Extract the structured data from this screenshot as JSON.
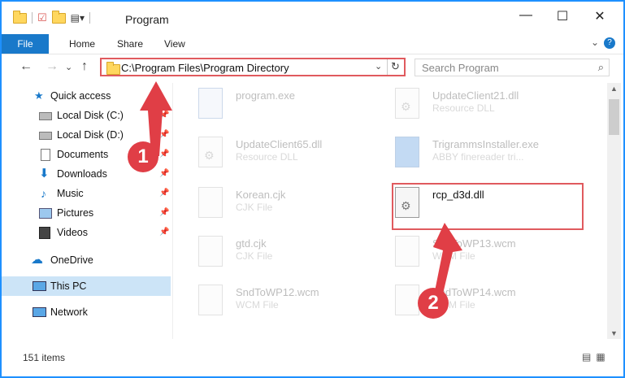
{
  "window": {
    "title": "Program",
    "minimize": "—",
    "maximize": "☐",
    "close": "✕"
  },
  "ribbon": {
    "tabs": [
      "File",
      "Home",
      "Share",
      "View"
    ],
    "help": "?"
  },
  "nav": {
    "back": "←",
    "forward": "→",
    "up": "↑",
    "address": "C:\\Program Files\\Program Directory",
    "search_placeholder": "Search Program"
  },
  "sidebar": {
    "items": [
      {
        "label": "Quick access",
        "icon": "star-icon",
        "pinned": false
      },
      {
        "label": "Local Disk (C:)",
        "icon": "drive-icon",
        "pinned": true
      },
      {
        "label": "Local Disk (D:)",
        "icon": "drive-icon",
        "pinned": true
      },
      {
        "label": "Documents",
        "icon": "document-icon",
        "pinned": true
      },
      {
        "label": "Downloads",
        "icon": "download-icon",
        "pinned": true
      },
      {
        "label": "Music",
        "icon": "music-icon",
        "pinned": true
      },
      {
        "label": "Pictures",
        "icon": "picture-icon",
        "pinned": true
      },
      {
        "label": "Videos",
        "icon": "video-icon",
        "pinned": true
      },
      {
        "label": "OneDrive",
        "icon": "cloud-icon",
        "pinned": false
      },
      {
        "label": "This PC",
        "icon": "computer-icon",
        "pinned": false,
        "selected": true
      },
      {
        "label": "Network",
        "icon": "network-icon",
        "pinned": false
      }
    ]
  },
  "files": [
    {
      "name": "program.exe",
      "type": ""
    },
    {
      "name": "UpdateClient21.dll",
      "type": "Resource DLL"
    },
    {
      "name": "UpdateClient65.dll",
      "type": "Resource DLL"
    },
    {
      "name": "TrigrammsInstaller.exe",
      "type": "ABBY finereader tri..."
    },
    {
      "name": "Korean.cjk",
      "type": "CJK File"
    },
    {
      "name": "rcp_d3d.dll",
      "type": ""
    },
    {
      "name": "gtd.cjk",
      "type": "CJK File"
    },
    {
      "name": "SndToWP13.wcm",
      "type": "WCM File"
    },
    {
      "name": "SndToWP12.wcm",
      "type": "WCM File"
    },
    {
      "name": "SndToWP14.wcm",
      "type": "WCM File"
    }
  ],
  "status": {
    "item_count": "151 items"
  },
  "annotations": {
    "step1": "1",
    "step2": "2"
  },
  "colors": {
    "accent": "#1979ca",
    "highlight": "#e05a5e",
    "badge": "#e03e46"
  }
}
